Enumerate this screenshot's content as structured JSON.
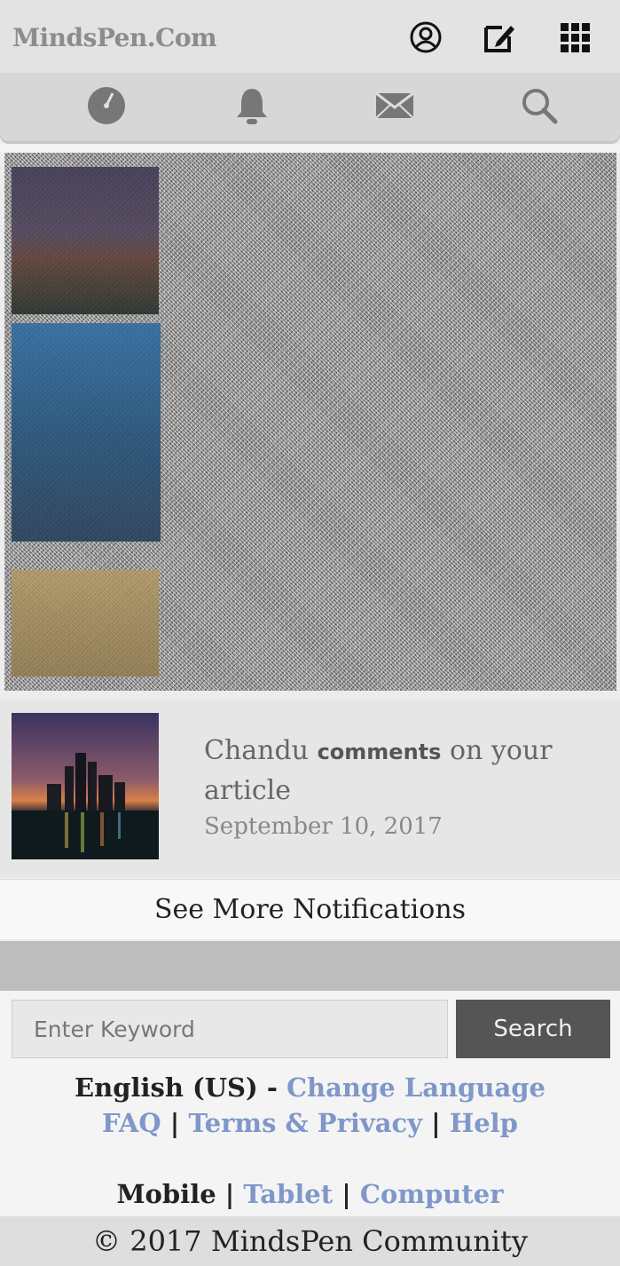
{
  "header": {
    "logo": "MindsPen.Com",
    "icons": [
      "profile-icon",
      "compose-icon",
      "apps-grid-icon"
    ]
  },
  "nav": {
    "icons": [
      "dashboard-icon",
      "bell-icon",
      "mail-icon",
      "search-icon"
    ]
  },
  "notification": {
    "actor": "Chandu",
    "action": "comments",
    "rest": "on your article",
    "date": "September 10, 2017"
  },
  "see_more": "See More Notifications",
  "search": {
    "placeholder": "Enter Keyword",
    "button": "Search"
  },
  "footer": {
    "language_current": "English (US)",
    "language_sep": " - ",
    "change_language": "Change Language",
    "faq": "FAQ",
    "terms": "Terms & Privacy",
    "help": "Help",
    "sep": " | ",
    "mobile": "Mobile",
    "tablet": "Tablet",
    "computer": "Computer",
    "copyright": "© 2017 MindsPen Community"
  }
}
